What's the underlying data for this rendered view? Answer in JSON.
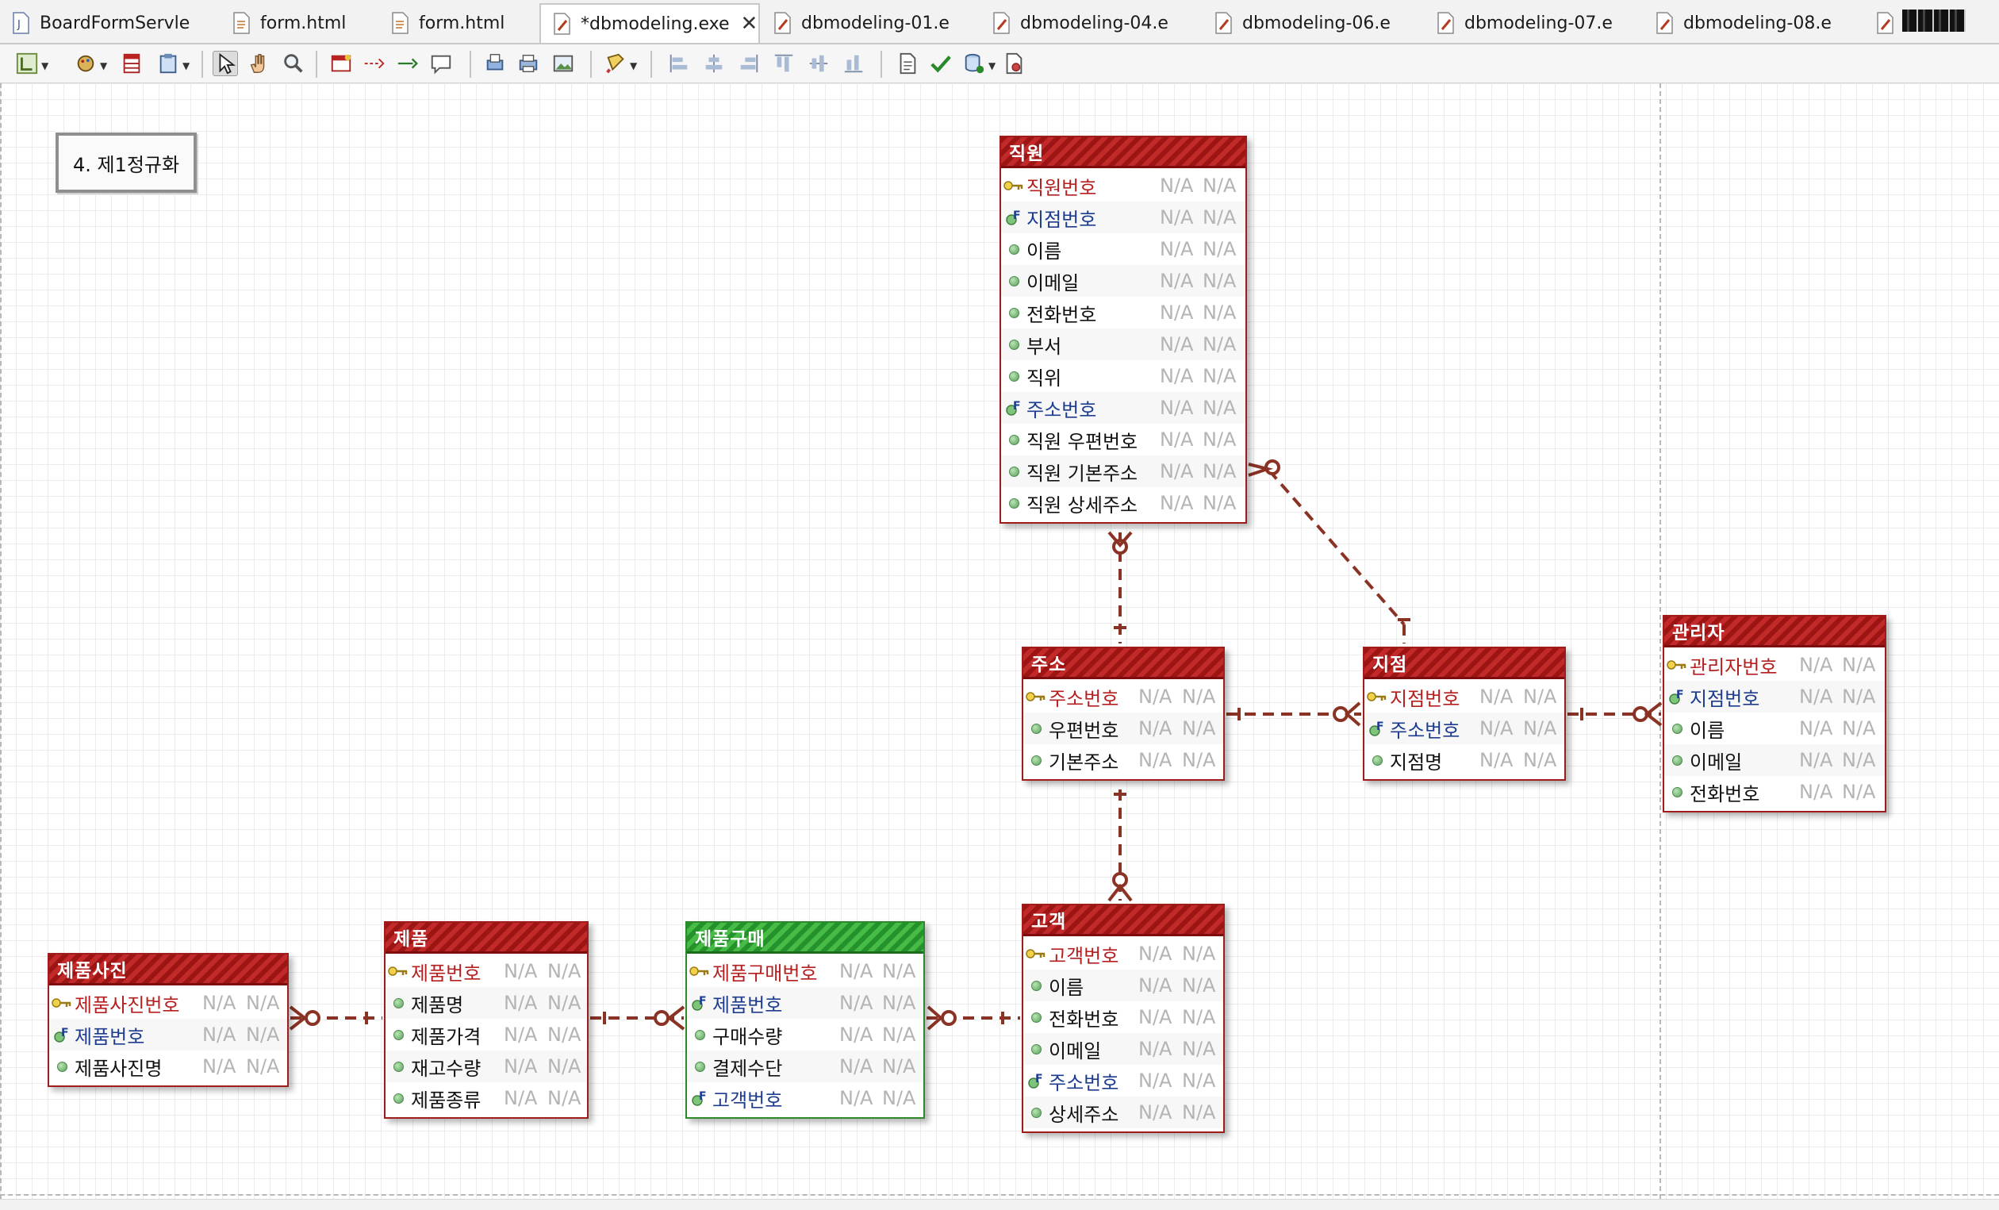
{
  "tabs": [
    {
      "label": "BoardFormServle",
      "icon": "java-file-icon",
      "active": false
    },
    {
      "label": "form.html",
      "icon": "html-file-icon",
      "active": false
    },
    {
      "label": "form.html",
      "icon": "html-file-icon",
      "active": false
    },
    {
      "label": "*dbmodeling.exe",
      "icon": "erd-file-icon",
      "active": true
    },
    {
      "label": "dbmodeling-01.e",
      "icon": "erd-file-icon",
      "active": false
    },
    {
      "label": "dbmodeling-04.e",
      "icon": "erd-file-icon",
      "active": false
    },
    {
      "label": "dbmodeling-06.e",
      "icon": "erd-file-icon",
      "active": false
    },
    {
      "label": "dbmodeling-07.e",
      "icon": "erd-file-icon",
      "active": false
    },
    {
      "label": "dbmodeling-08.e",
      "icon": "erd-file-icon",
      "active": false
    },
    {
      "label": "",
      "icon": "erd-file-icon",
      "active": false
    }
  ],
  "toolbar": [
    {
      "name": "layout-icon",
      "dropdown": true
    },
    {
      "name": "palette-icon",
      "dropdown": true
    },
    {
      "name": "table-icon",
      "dropdown": false
    },
    {
      "name": "clipboard-icon",
      "dropdown": true
    },
    {
      "sep": true
    },
    {
      "name": "select-arrow-icon",
      "pressed": true
    },
    {
      "name": "hand-icon"
    },
    {
      "name": "zoom-icon"
    },
    {
      "sep": true
    },
    {
      "name": "new-table-icon"
    },
    {
      "name": "relation-red-icon"
    },
    {
      "name": "relation-green-icon"
    },
    {
      "name": "note-icon"
    },
    {
      "sep": true
    },
    {
      "name": "print-preview-icon"
    },
    {
      "name": "print-icon"
    },
    {
      "name": "image-export-icon"
    },
    {
      "sep": true
    },
    {
      "name": "paint-icon",
      "dropdown": true
    },
    {
      "sep": true
    },
    {
      "name": "align-left-icon"
    },
    {
      "name": "align-center-icon"
    },
    {
      "name": "align-right-icon"
    },
    {
      "name": "align-top-icon"
    },
    {
      "name": "align-middle-icon"
    },
    {
      "name": "align-bottom-icon"
    },
    {
      "sep": true
    },
    {
      "name": "document-icon"
    },
    {
      "name": "check-icon"
    },
    {
      "name": "database-icon",
      "dropdown": true
    },
    {
      "name": "settings-doc-icon"
    }
  ],
  "note": "4. 제1정규화",
  "entities": [
    {
      "id": "employee",
      "title": "직원",
      "color": "red",
      "rows": [
        {
          "name": "직원번호",
          "key": "pk",
          "type": "N/A",
          "null": "N/A"
        },
        {
          "name": "지점번호",
          "key": "fk",
          "type": "N/A",
          "null": "N/A"
        },
        {
          "name": "이름",
          "key": "",
          "type": "N/A",
          "null": "N/A"
        },
        {
          "name": "이메일",
          "key": "",
          "type": "N/A",
          "null": "N/A"
        },
        {
          "name": "전화번호",
          "key": "",
          "type": "N/A",
          "null": "N/A"
        },
        {
          "name": "부서",
          "key": "",
          "type": "N/A",
          "null": "N/A"
        },
        {
          "name": "직위",
          "key": "",
          "type": "N/A",
          "null": "N/A"
        },
        {
          "name": "주소번호",
          "key": "fk",
          "type": "N/A",
          "null": "N/A"
        },
        {
          "name": "직원 우편번호",
          "key": "",
          "type": "N/A",
          "null": "N/A"
        },
        {
          "name": "직원 기본주소",
          "key": "",
          "type": "N/A",
          "null": "N/A"
        },
        {
          "name": "직원 상세주소",
          "key": "",
          "type": "N/A",
          "null": "N/A"
        }
      ]
    },
    {
      "id": "address",
      "title": "주소",
      "color": "red",
      "rows": [
        {
          "name": "주소번호",
          "key": "pk",
          "type": "N/A",
          "null": "N/A"
        },
        {
          "name": "우편번호",
          "key": "",
          "type": "N/A",
          "null": "N/A"
        },
        {
          "name": "기본주소",
          "key": "",
          "type": "N/A",
          "null": "N/A"
        }
      ]
    },
    {
      "id": "branch",
      "title": "지점",
      "color": "red",
      "rows": [
        {
          "name": "지점번호",
          "key": "pk",
          "type": "N/A",
          "null": "N/A"
        },
        {
          "name": "주소번호",
          "key": "fk",
          "type": "N/A",
          "null": "N/A"
        },
        {
          "name": "지점명",
          "key": "",
          "type": "N/A",
          "null": "N/A"
        }
      ]
    },
    {
      "id": "manager",
      "title": "관리자",
      "color": "red",
      "rows": [
        {
          "name": "관리자번호",
          "key": "pk",
          "type": "N/A",
          "null": "N/A"
        },
        {
          "name": "지점번호",
          "key": "fk",
          "type": "N/A",
          "null": "N/A"
        },
        {
          "name": "이름",
          "key": "",
          "type": "N/A",
          "null": "N/A"
        },
        {
          "name": "이메일",
          "key": "",
          "type": "N/A",
          "null": "N/A"
        },
        {
          "name": "전화번호",
          "key": "",
          "type": "N/A",
          "null": "N/A"
        }
      ]
    },
    {
      "id": "customer",
      "title": "고객",
      "color": "red",
      "rows": [
        {
          "name": "고객번호",
          "key": "pk",
          "type": "N/A",
          "null": "N/A"
        },
        {
          "name": "이름",
          "key": "",
          "type": "N/A",
          "null": "N/A"
        },
        {
          "name": "전화번호",
          "key": "",
          "type": "N/A",
          "null": "N/A"
        },
        {
          "name": "이메일",
          "key": "",
          "type": "N/A",
          "null": "N/A"
        },
        {
          "name": "주소번호",
          "key": "fk",
          "type": "N/A",
          "null": "N/A"
        },
        {
          "name": "상세주소",
          "key": "",
          "type": "N/A",
          "null": "N/A"
        }
      ]
    },
    {
      "id": "purchase",
      "title": "제품구매",
      "color": "green",
      "rows": [
        {
          "name": "제품구매번호",
          "key": "pk",
          "type": "N/A",
          "null": "N/A"
        },
        {
          "name": "제품번호",
          "key": "fk",
          "type": "N/A",
          "null": "N/A"
        },
        {
          "name": "구매수량",
          "key": "",
          "type": "N/A",
          "null": "N/A"
        },
        {
          "name": "결제수단",
          "key": "",
          "type": "N/A",
          "null": "N/A"
        },
        {
          "name": "고객번호",
          "key": "fk",
          "type": "N/A",
          "null": "N/A"
        }
      ]
    },
    {
      "id": "product",
      "title": "제품",
      "color": "red",
      "rows": [
        {
          "name": "제품번호",
          "key": "pk",
          "type": "N/A",
          "null": "N/A"
        },
        {
          "name": "제품명",
          "key": "",
          "type": "N/A",
          "null": "N/A"
        },
        {
          "name": "제품가격",
          "key": "",
          "type": "N/A",
          "null": "N/A"
        },
        {
          "name": "재고수량",
          "key": "",
          "type": "N/A",
          "null": "N/A"
        },
        {
          "name": "제품종류",
          "key": "",
          "type": "N/A",
          "null": "N/A"
        }
      ]
    },
    {
      "id": "product_photo",
      "title": "제품사진",
      "color": "red",
      "rows": [
        {
          "name": "제품사진번호",
          "key": "pk",
          "type": "N/A",
          "null": "N/A"
        },
        {
          "name": "제품번호",
          "key": "fk",
          "type": "N/A",
          "null": "N/A"
        },
        {
          "name": "제품사진명",
          "key": "",
          "type": "N/A",
          "null": "N/A"
        }
      ]
    }
  ],
  "relationships": [
    {
      "from": "address",
      "to": "employee",
      "cardinality": "one-to-zero-or-many"
    },
    {
      "from": "branch",
      "to": "employee",
      "cardinality": "one-to-zero-or-many"
    },
    {
      "from": "address",
      "to": "branch",
      "cardinality": "one-to-zero-or-many"
    },
    {
      "from": "branch",
      "to": "manager",
      "cardinality": "one-to-zero-or-many"
    },
    {
      "from": "address",
      "to": "customer",
      "cardinality": "one-to-zero-or-many"
    },
    {
      "from": "customer",
      "to": "purchase",
      "cardinality": "one-to-zero-or-many"
    },
    {
      "from": "product",
      "to": "purchase",
      "cardinality": "one-to-zero-or-many"
    },
    {
      "from": "product",
      "to": "product_photo",
      "cardinality": "one-to-zero-or-many"
    }
  ],
  "colors": {
    "entity_red": "#9e1c1c",
    "entity_green": "#2c8a2c",
    "connector": "#8a3324",
    "pk_text": "#b51f1f",
    "fk_text": "#1d3c8f"
  }
}
